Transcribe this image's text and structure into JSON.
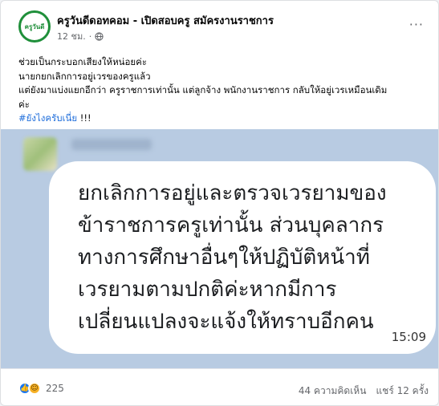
{
  "post": {
    "page_name": "ครูวันดีดอทคอม - เปิดสอบครู สมัครงานราชการ",
    "avatar_text": "ครูวันดี",
    "time": "12 ชม.",
    "more": "···",
    "lines": [
      "ช่วยเป็นกระบอกเสียงให้หน่อยค่ะ",
      "นายกยกเลิกการอยู่เวรของครูแล้ว",
      "แต่ยังมาแบ่งแยกอีกว่า ครูราชการเท่านั้น แต่ลูกจ้าง พนักงานราชการ กลับให้อยู่เวรเหมือนเดิม",
      "ค่ะ"
    ],
    "hashtag": "#ยังไงครับเนี่ย",
    "hashtag_suffix": " !!!"
  },
  "image": {
    "bubble_lines": [
      "ยกเลิกการอยู่และตรวจเวรยามของ",
      "ข้าราชการครูเท่านั้น ส่วนบุคลากร",
      "ทางการศึกษาอื่นๆให้ปฏิบัติหน้าที่",
      "เวรยามตามปกติค่ะหากมีการ",
      "เปลี่ยนแปลงจะแจ้งให้ทราบอีกคน"
    ],
    "time": "15:09"
  },
  "footer": {
    "reaction_count": "225",
    "comments": "44 ความคิดเห็น",
    "shares": "แชร์ 12 ครั้ง"
  },
  "colors": {
    "accent": "#216fdb",
    "like": "#1877f2",
    "haha": "#f7b125",
    "media_bg": "#b8cbe2"
  }
}
